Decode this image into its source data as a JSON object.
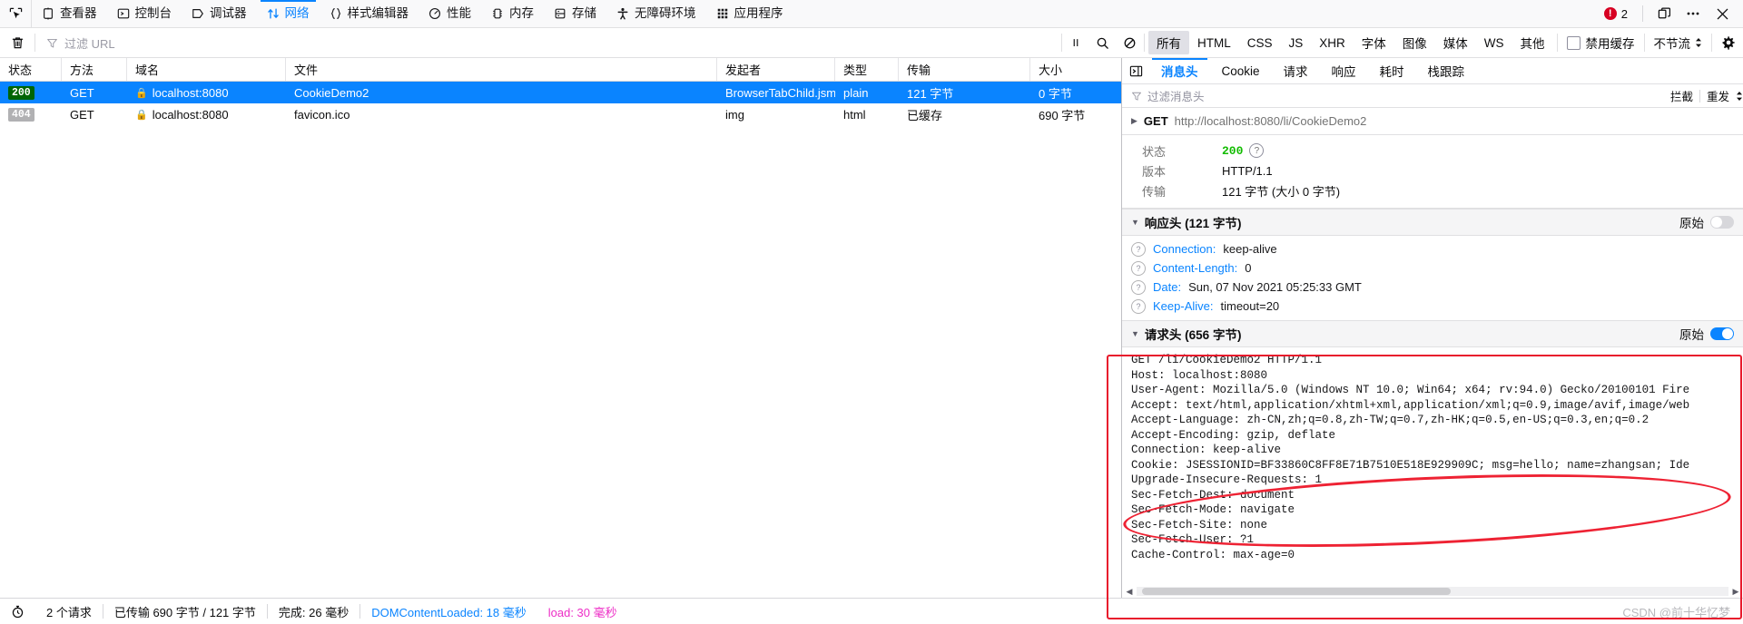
{
  "toolbar": {
    "picker_icon": "element-picker-icon",
    "tabs": [
      {
        "label": "查看器",
        "icon": "inspector-icon",
        "selected": false
      },
      {
        "label": "控制台",
        "icon": "console-icon",
        "selected": false
      },
      {
        "label": "调试器",
        "icon": "debugger-icon",
        "selected": false
      },
      {
        "label": "网络",
        "icon": "network-icon",
        "selected": true
      },
      {
        "label": "样式编辑器",
        "icon": "style-editor-icon",
        "selected": false
      },
      {
        "label": "性能",
        "icon": "performance-icon",
        "selected": false
      },
      {
        "label": "内存",
        "icon": "memory-icon",
        "selected": false
      },
      {
        "label": "存储",
        "icon": "storage-icon",
        "selected": false
      },
      {
        "label": "无障碍环境",
        "icon": "accessibility-icon",
        "selected": false
      },
      {
        "label": "应用程序",
        "icon": "application-icon",
        "selected": false
      }
    ],
    "error_count": "2",
    "error_icon": "error-circle-icon",
    "dock_icon": "dock-layout-icon",
    "meatball_icon": "more-options-icon",
    "close_icon": "close-icon"
  },
  "net_toolbar": {
    "trash_icon": "trash-icon",
    "filter_icon": "funnel-icon",
    "filter_placeholder": "过滤 URL",
    "pause_icon": "pause-icon",
    "search_icon": "search-icon",
    "block_icon": "block-requests-icon",
    "type_filters": [
      {
        "label": "所有",
        "active": true
      },
      {
        "label": "HTML",
        "active": false
      },
      {
        "label": "CSS",
        "active": false
      },
      {
        "label": "JS",
        "active": false
      },
      {
        "label": "XHR",
        "active": false
      },
      {
        "label": "字体",
        "active": false
      },
      {
        "label": "图像",
        "active": false
      },
      {
        "label": "媒体",
        "active": false
      },
      {
        "label": "WS",
        "active": false
      },
      {
        "label": "其他",
        "active": false
      }
    ],
    "disable_cache_label": "禁用缓存",
    "throttle_label": "不节流",
    "gear_icon": "settings-gear-icon"
  },
  "request_table": {
    "columns": [
      "状态",
      "方法",
      "域名",
      "文件",
      "发起者",
      "类型",
      "传输",
      "大小"
    ],
    "rows": [
      {
        "status": "200",
        "status_kind": "ok",
        "method": "GET",
        "domain": "localhost:8080",
        "secure": true,
        "file": "CookieDemo2",
        "initiator": "BrowserTabChild.jsm:...",
        "type": "plain",
        "transfer": "121 字节",
        "size": "0 字节",
        "selected": true
      },
      {
        "status": "404",
        "status_kind": "err",
        "method": "GET",
        "domain": "localhost:8080",
        "secure": true,
        "file": "favicon.ico",
        "initiator": "img",
        "type": "html",
        "transfer": "已缓存",
        "size": "690 字节",
        "selected": false
      }
    ]
  },
  "details": {
    "expand_icon": "panel-toggle-icon",
    "tabs": [
      {
        "label": "消息头",
        "selected": true
      },
      {
        "label": "Cookie",
        "selected": false
      },
      {
        "label": "请求",
        "selected": false
      },
      {
        "label": "响应",
        "selected": false
      },
      {
        "label": "耗时",
        "selected": false
      },
      {
        "label": "栈跟踪",
        "selected": false
      }
    ],
    "header_filter_placeholder": "过滤消息头",
    "block_label": "拦截",
    "resend_label": "重发",
    "url_method": "GET",
    "url": "http://localhost:8080/li/CookieDemo2",
    "summary": [
      {
        "key": "状态",
        "value": "200",
        "kind": "status"
      },
      {
        "key": "版本",
        "value": "HTTP/1.1",
        "kind": "text"
      },
      {
        "key": "传输",
        "value": "121 字节 (大小 0 字节)",
        "kind": "text"
      }
    ],
    "response_section": {
      "title": "响应头 (121 字节)",
      "raw_label": "原始",
      "raw_on": false,
      "headers": [
        {
          "name": "Connection:",
          "value": "keep-alive"
        },
        {
          "name": "Content-Length:",
          "value": "0"
        },
        {
          "name": "Date:",
          "value": "Sun, 07 Nov 2021 05:25:33 GMT"
        },
        {
          "name": "Keep-Alive:",
          "value": "timeout=20"
        }
      ]
    },
    "request_section": {
      "title": "请求头 (656 字节)",
      "raw_label": "原始",
      "raw_on": true,
      "raw_text": "GET /li/CookieDemo2 HTTP/1.1\nHost: localhost:8080\nUser-Agent: Mozilla/5.0 (Windows NT 10.0; Win64; x64; rv:94.0) Gecko/20100101 Fire\nAccept: text/html,application/xhtml+xml,application/xml;q=0.9,image/avif,image/web\nAccept-Language: zh-CN,zh;q=0.8,zh-TW;q=0.7,zh-HK;q=0.5,en-US;q=0.3,en;q=0.2\nAccept-Encoding: gzip, deflate\nConnection: keep-alive\nCookie: JSESSIONID=BF33860C8FF8E71B7510E518E929909C; msg=hello; name=zhangsan; Ide\nUpgrade-Insecure-Requests: 1\nSec-Fetch-Dest: document\nSec-Fetch-Mode: navigate\nSec-Fetch-Site: none\nSec-Fetch-User: ?1\nCache-Control: max-age=0"
    }
  },
  "statusbar": {
    "clock_icon": "stopwatch-icon",
    "requests": "2 个请求",
    "transferred": "已传输 690 字节 / 121 字节",
    "finish": "完成: 26 毫秒",
    "domcontentloaded": "DOMContentLoaded: 18 毫秒",
    "load": "load: 30 毫秒",
    "watermark": "CSDN @前十华忆梦"
  }
}
